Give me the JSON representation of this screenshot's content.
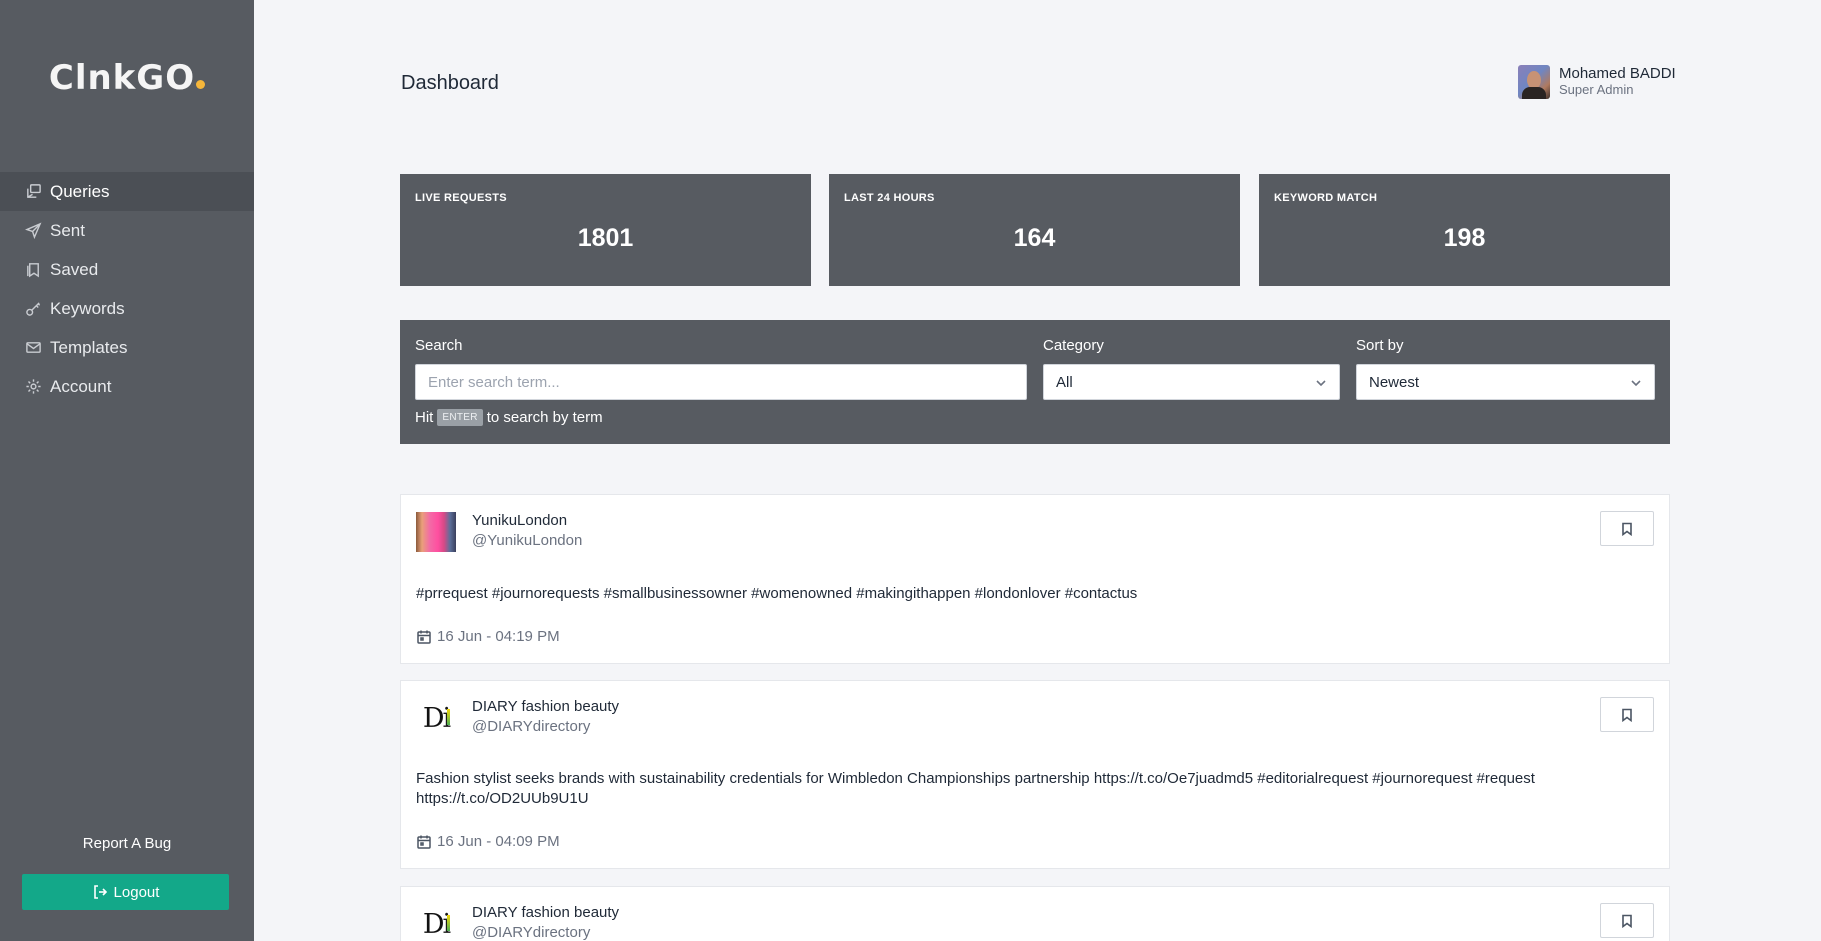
{
  "app": {
    "logo_text": "ClnkGO",
    "page_title": "Dashboard"
  },
  "sidebar": {
    "items": [
      {
        "label": "Queries",
        "icon": "queries-icon",
        "active": true
      },
      {
        "label": "Sent",
        "icon": "send-icon"
      },
      {
        "label": "Saved",
        "icon": "bookmarks-icon"
      },
      {
        "label": "Keywords",
        "icon": "key-icon"
      },
      {
        "label": "Templates",
        "icon": "mail-icon"
      },
      {
        "label": "Account",
        "icon": "gear-icon"
      }
    ],
    "report_bug": "Report A Bug",
    "logout": "Logout"
  },
  "user": {
    "name": "Mohamed BADDI",
    "role": "Super Admin"
  },
  "stats": [
    {
      "label": "LIVE REQUESTS",
      "value": "1801"
    },
    {
      "label": "LAST 24 HOURS",
      "value": "164"
    },
    {
      "label": "KEYWORD MATCH",
      "value": "198"
    }
  ],
  "filters": {
    "search_label": "Search",
    "search_placeholder": "Enter search term...",
    "category_label": "Category",
    "category_value": "All",
    "sort_label": "Sort by",
    "sort_value": "Newest",
    "hint_prefix": "Hit",
    "hint_key": "ENTER",
    "hint_suffix": "to search by term"
  },
  "posts": [
    {
      "name": "YunikuLondon",
      "handle": "@YunikuLondon",
      "text": "#prrequest #journorequests #smallbusinessowner #womenowned #makingithappen #londonlover #contactus",
      "date": "16 Jun - 04:19 PM"
    },
    {
      "name": "DIARY fashion beauty",
      "handle": "@DIARYdirectory",
      "text": "Fashion stylist seeks brands with sustainability credentials for Wimbledon Championships partnership https://t.co/Oe7juadmd5 #editorialrequest #journorequest #request https://t.co/OD2UUb9U1U",
      "date": "16 Jun - 04:09 PM"
    },
    {
      "name": "DIARY fashion beauty",
      "handle": "@DIARYdirectory"
    }
  ],
  "colors": {
    "sidebar": "#575b61",
    "accent": "#13a889",
    "panel": "#575b61",
    "background": "#f4f5f8"
  }
}
